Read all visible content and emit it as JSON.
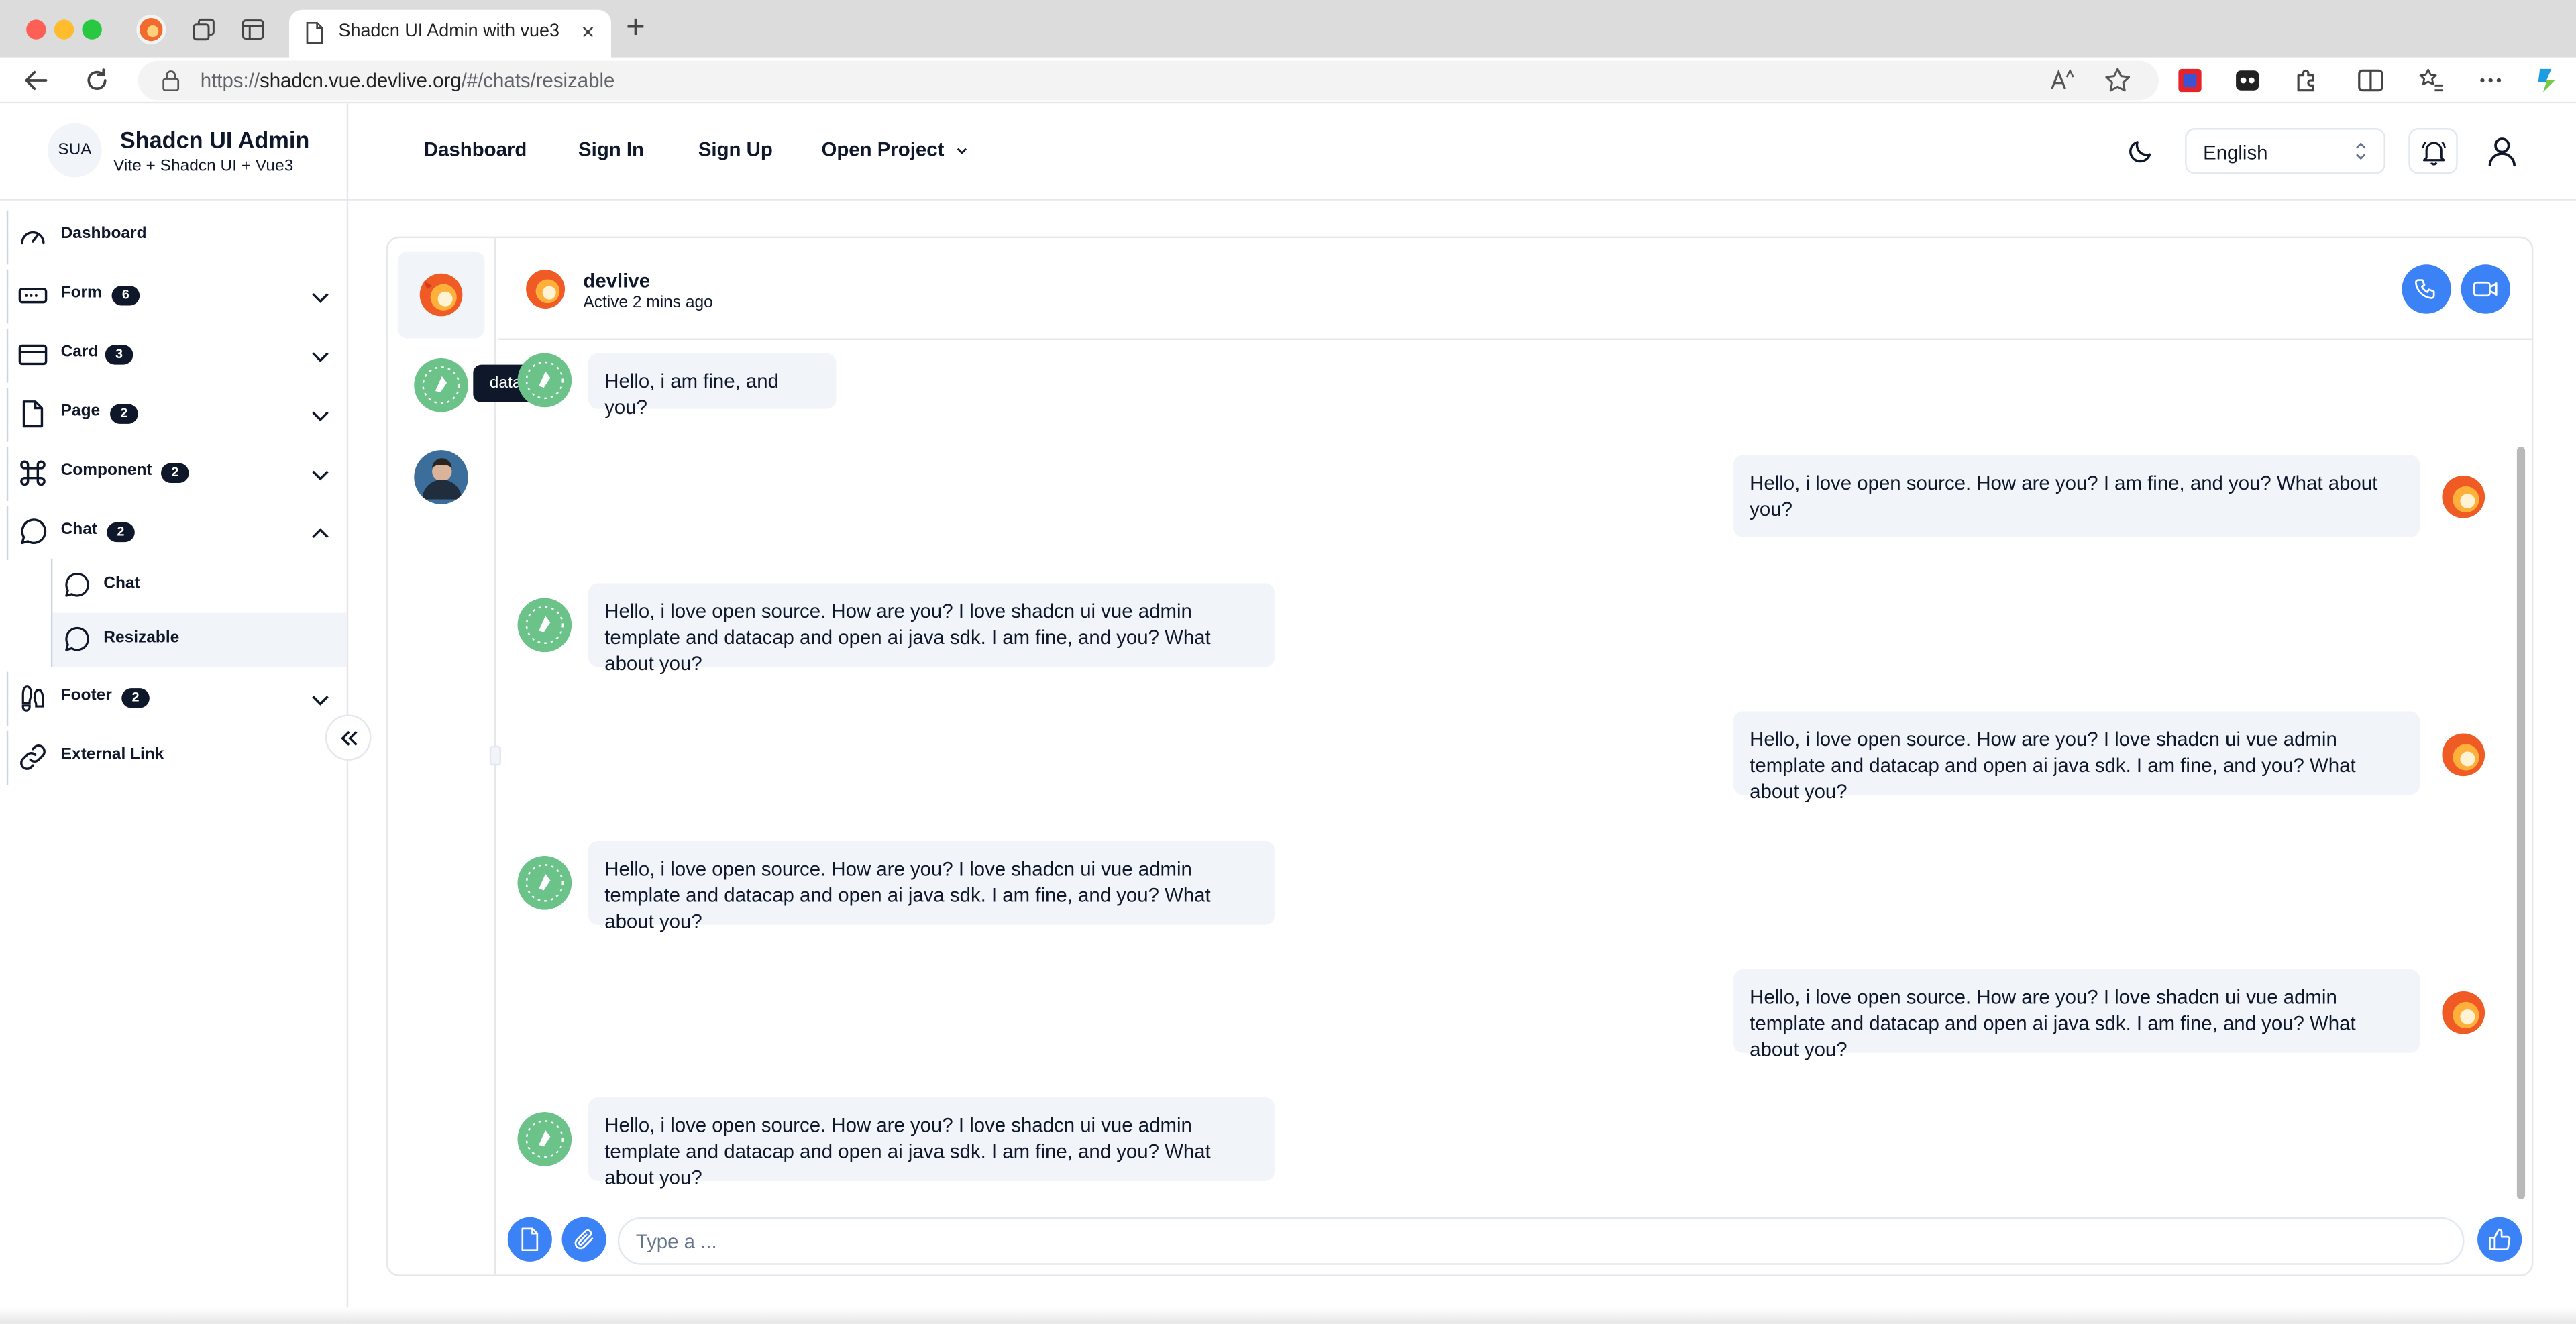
{
  "browser": {
    "tab_title": "Shadcn UI Admin with vue3",
    "tab_close": "×",
    "new_tab": "+",
    "url_prefix": "https://",
    "url_host": "shadcn.vue.devlive.org",
    "url_path": "/#/chats/resizable"
  },
  "brand": {
    "avatar": "SUA",
    "title": "Shadcn UI Admin",
    "subtitle": "Vite + Shadcn UI + Vue3"
  },
  "topnav": {
    "dashboard": "Dashboard",
    "sign_in": "Sign In",
    "sign_up": "Sign Up",
    "open_project": "Open Project"
  },
  "language": {
    "selected": "English"
  },
  "sidebar": {
    "dashboard": "Dashboard",
    "form": {
      "label": "Form",
      "count": "6"
    },
    "card": {
      "label": "Card",
      "count": "3"
    },
    "page": {
      "label": "Page",
      "count": "2"
    },
    "component": {
      "label": "Component",
      "count": "2"
    },
    "chat": {
      "label": "Chat",
      "count": "2"
    },
    "chat_sub": [
      "Chat",
      "Resizable"
    ],
    "footer": {
      "label": "Footer",
      "count": "2"
    },
    "external": "External Link"
  },
  "chat": {
    "contact_name": "devlive",
    "contact_status": "Active 2 mins ago",
    "tooltip": "datacap",
    "messages": [
      {
        "side": "left",
        "text": "Hello, i am fine, and you?"
      },
      {
        "side": "right",
        "text": "Hello, i love open source. How are you? I am fine, and you? What about you?"
      },
      {
        "side": "left",
        "text": "Hello, i love open source. How are you? I love shadcn ui vue admin template and datacap and open ai java sdk. I am fine, and you? What about you?"
      },
      {
        "side": "right",
        "text": "Hello, i love open source. How are you? I love shadcn ui vue admin template and datacap and open ai java sdk. I am fine, and you? What about you?"
      },
      {
        "side": "left",
        "text": "Hello, i love open source. How are you? I love shadcn ui vue admin template and datacap and open ai java sdk. I am fine, and you? What about you?"
      },
      {
        "side": "right",
        "text": "Hello, i love open source. How are you? I love shadcn ui vue admin template and datacap and open ai java sdk. I am fine, and you? What about you?"
      },
      {
        "side": "left",
        "text": "Hello, i love open source. How are you? I love shadcn ui vue admin template and datacap and open ai java sdk. I am fine, and you? What about you?"
      }
    ],
    "input_placeholder": "Type a ..."
  },
  "icons": {
    "dashboard": "gauge-icon",
    "form": "input-icon",
    "card": "credit-card-icon",
    "page": "file-icon",
    "component": "command-icon",
    "chat": "message-circle-icon",
    "footer": "footprints-icon",
    "external": "link-icon"
  },
  "colors": {
    "accent": "#3b82f6",
    "badge": "#0f172a",
    "bubble": "#f1f5f9"
  }
}
